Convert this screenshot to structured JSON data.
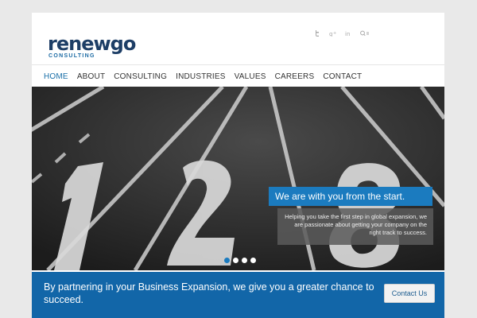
{
  "logo": {
    "name_part1": "renew",
    "name_part2": "go",
    "subtitle": "CONSULTING"
  },
  "social": {
    "twitter_icon": "twitter-icon",
    "googleplus_icon": "googleplus-icon",
    "linkedin_icon": "linkedin-icon",
    "search_icon": "search-icon"
  },
  "nav": {
    "items": [
      {
        "label": "HOME",
        "active": true
      },
      {
        "label": "ABOUT"
      },
      {
        "label": "CONSULTING"
      },
      {
        "label": "INDUSTRIES"
      },
      {
        "label": "VALUES"
      },
      {
        "label": "CAREERS"
      },
      {
        "label": "CONTACT"
      }
    ]
  },
  "slider": {
    "caption_title": "We are with you from the start.",
    "caption_text": "Helping you take the first step in global expansion, we are passionate about getting your company on the right track to success.",
    "dots": 4,
    "active_dot": 0
  },
  "banner": {
    "text": "By partnering in your Business Expansion, we give you a greater chance to succeed.",
    "button_label": "Contact Us"
  },
  "colors": {
    "brand": "#1b7bbf",
    "banner": "#1266a8",
    "nav_active": "#1a6fa8"
  }
}
